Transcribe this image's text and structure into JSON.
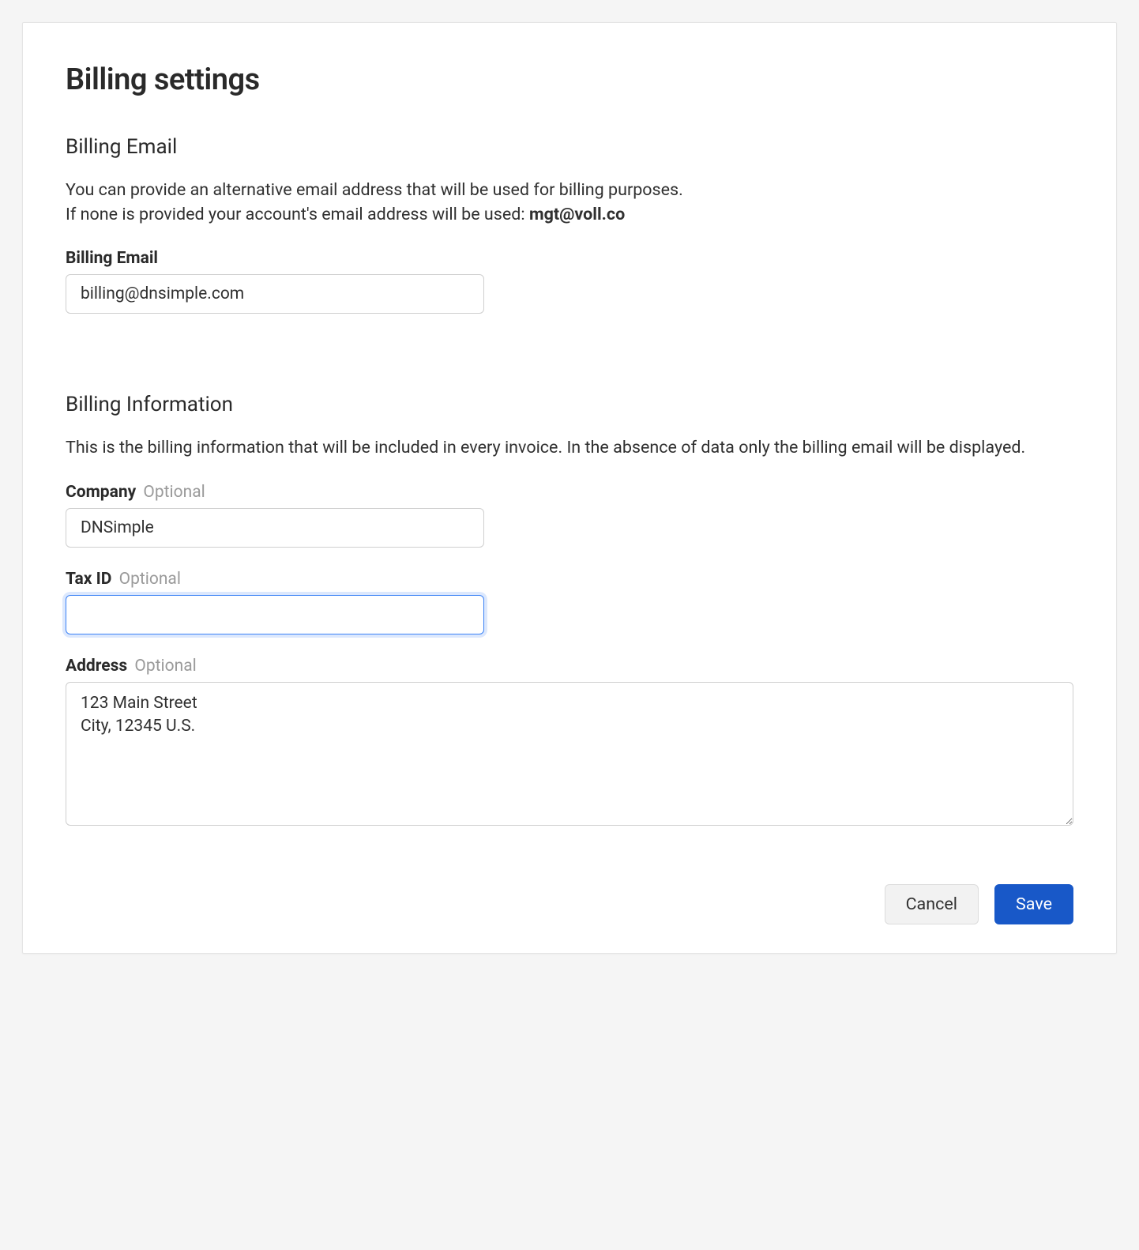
{
  "page": {
    "title": "Billing settings"
  },
  "billing_email_section": {
    "heading": "Billing Email",
    "description_line1": "You can provide an alternative email address that will be used for billing purposes.",
    "description_line2_prefix": "If none is provided your account's email address will be used: ",
    "account_email": "mgt@voll.co",
    "field_label": "Billing Email",
    "field_value": "billing@dnsimple.com"
  },
  "billing_info_section": {
    "heading": "Billing Information",
    "description": "This is the billing information that will be included in every invoice. In the absence of data only the billing email will be displayed.",
    "company_label": "Company",
    "company_optional": "Optional",
    "company_value": "DNSimple",
    "tax_id_label": "Tax ID",
    "tax_id_optional": "Optional",
    "tax_id_value": "",
    "address_label": "Address",
    "address_optional": "Optional",
    "address_value": "123 Main Street\nCity, 12345 U.S."
  },
  "buttons": {
    "cancel": "Cancel",
    "save": "Save"
  }
}
